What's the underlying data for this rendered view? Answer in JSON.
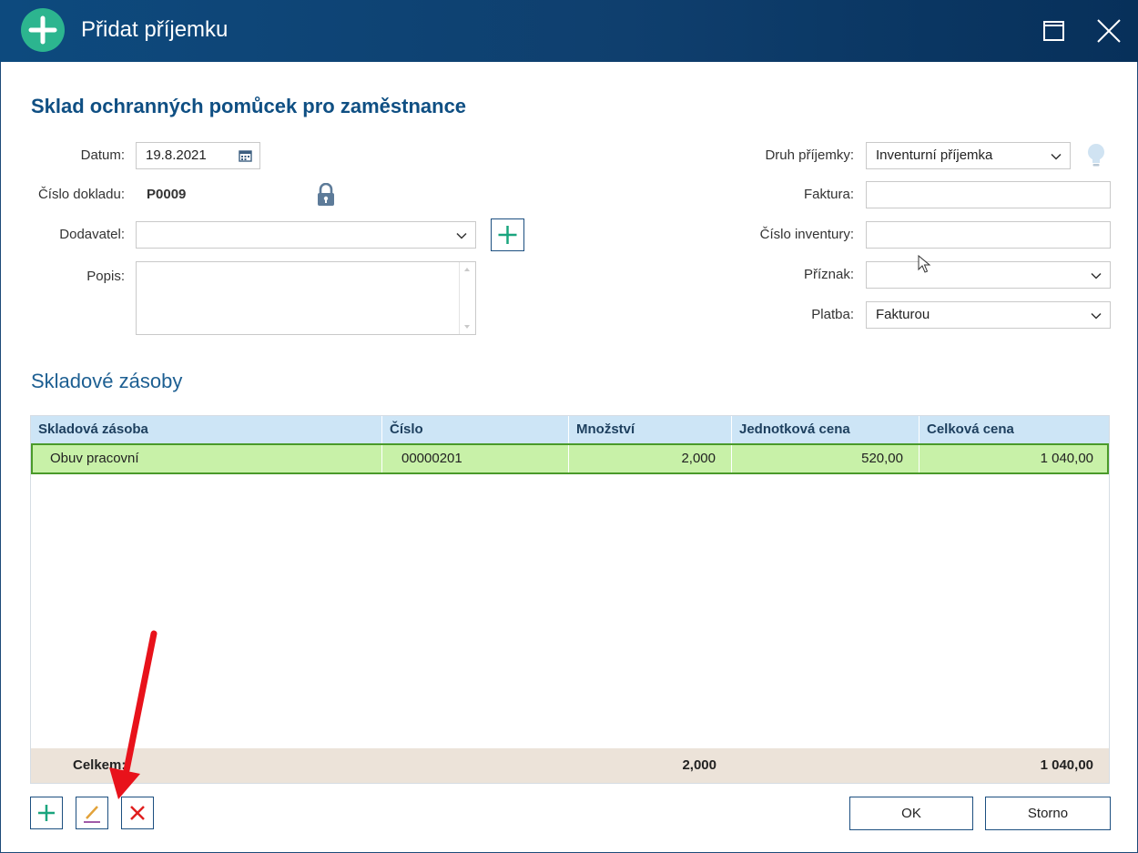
{
  "window": {
    "title": "Přidat příjemku"
  },
  "heading": "Sklad ochranných pomůcek pro zaměstnance",
  "form_left": {
    "datum_label": "Datum:",
    "datum_value": "19.8.2021",
    "cislo_label": "Číslo dokladu:",
    "cislo_value": "P0009",
    "dodavatel_label": "Dodavatel:",
    "dodavatel_value": "",
    "popis_label": "Popis:",
    "popis_value": ""
  },
  "form_right": {
    "druh_label": "Druh příjemky:",
    "druh_value": "Inventurní příjemka",
    "faktura_label": "Faktura:",
    "faktura_value": "",
    "inventura_label": "Číslo inventury:",
    "inventura_value": "",
    "priznak_label": "Příznak:",
    "priznak_value": "",
    "platba_label": "Platba:",
    "platba_value": "Fakturou"
  },
  "section_title": "Skladové zásoby",
  "table": {
    "columns": [
      "Skladová zásoba",
      "Číslo",
      "Množství",
      "Jednotková cena",
      "Celková cena"
    ],
    "rows": [
      {
        "zasoba": "Obuv pracovní",
        "cislo": "00000201",
        "mnozstvi": "2,000",
        "jednotkova": "520,00",
        "celkova": "1 040,00"
      }
    ],
    "footer": {
      "label": "Celkem:",
      "mnozstvi": "2,000",
      "celkova": "1 040,00"
    }
  },
  "buttons": {
    "ok": "OK",
    "storno": "Storno"
  },
  "colors": {
    "titlebar": "#0f3f6e",
    "accent_green": "#2cb58f",
    "selected_row": "#c8f1a8",
    "header_row": "#cde5f6",
    "footer_row": "#ece3d9",
    "arrow": "#e8121b"
  }
}
